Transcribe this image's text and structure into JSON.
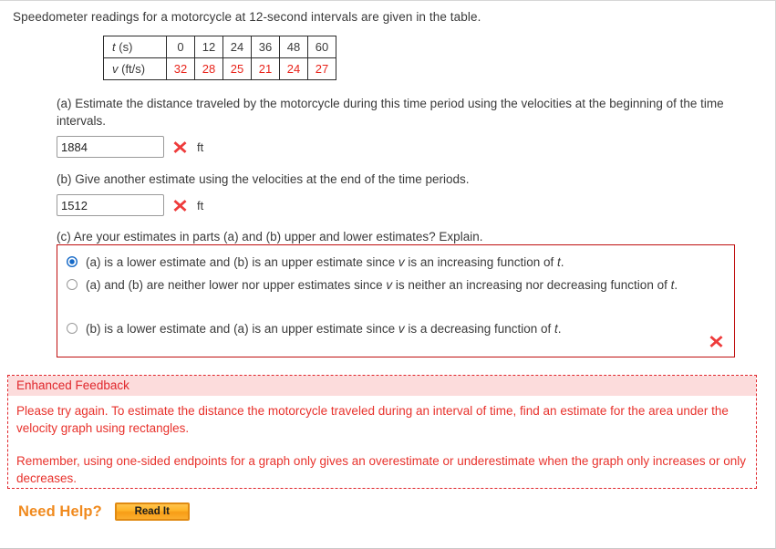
{
  "intro": {
    "text": "Speedometer readings for a motorcycle at 12-second intervals are given in the table."
  },
  "table": {
    "row_t_label_var": "t",
    "row_t_label_unit": " (s)",
    "row_v_label_var": "v",
    "row_v_label_unit": " (ft/s)",
    "t_values": [
      "0",
      "12",
      "24",
      "36",
      "48",
      "60"
    ],
    "v_values": [
      "32",
      "28",
      "25",
      "21",
      "24",
      "27"
    ],
    "value_color": "#e8241b"
  },
  "part_a": {
    "prompt": "(a) Estimate the distance traveled by the motorcycle during this time period using the velocities at the beginning of the time intervals.",
    "input_value": "1884",
    "input_placeholder": "",
    "unit": "ft",
    "status": "incorrect"
  },
  "part_b": {
    "prompt": "(b) Give another estimate using the velocities at the end of the time periods.",
    "input_value": "1512",
    "input_placeholder": "",
    "unit": "ft",
    "status": "incorrect"
  },
  "part_c": {
    "prompt": "(c) Are your estimates in parts (a) and (b) upper and lower estimates? Explain.",
    "status": "incorrect",
    "options": [
      {
        "id": "opt-increasing",
        "selected": true,
        "segments": [
          {
            "text": "(a) is a lower estimate and (b) is an upper estimate since ",
            "italic": false
          },
          {
            "text": "v",
            "italic": true
          },
          {
            "text": " is an increasing function of ",
            "italic": false
          },
          {
            "text": "t",
            "italic": true
          },
          {
            "text": ".",
            "italic": false
          }
        ]
      },
      {
        "id": "opt-neither",
        "selected": false,
        "segments": [
          {
            "text": "(a) and (b) are neither lower nor upper estimates since ",
            "italic": false
          },
          {
            "text": "v",
            "italic": true
          },
          {
            "text": " is neither an increasing nor decreasing function of ",
            "italic": false
          },
          {
            "text": "t",
            "italic": true
          },
          {
            "text": ".",
            "italic": false
          }
        ]
      },
      {
        "id": "opt-decreasing",
        "selected": false,
        "segments": [
          {
            "text": "(b) is a lower estimate and (a) is an upper estimate since ",
            "italic": false
          },
          {
            "text": "v",
            "italic": true
          },
          {
            "text": " is a decreasing function of ",
            "italic": false
          },
          {
            "text": "t",
            "italic": true
          },
          {
            "text": ".",
            "italic": false
          }
        ]
      }
    ]
  },
  "feedback": {
    "title": "Enhanced Feedback",
    "paragraph_1": "Please try again. To estimate the distance the motorcycle traveled during an interval of time, find an estimate for the area under the velocity graph using rectangles.",
    "paragraph_2": "Remember, using one-sided endpoints for a graph only gives an overestimate or underestimate when the graph only increases or only decreases.",
    "border_color": "#e0272c",
    "title_bg": "#fcdcdc",
    "text_color": "#e8322c"
  },
  "need_help": {
    "label": "Need Help?",
    "button_label": "Read It",
    "label_color": "#f08a1e"
  },
  "icons": {
    "incorrect_mark": "cross-mark-icon"
  }
}
